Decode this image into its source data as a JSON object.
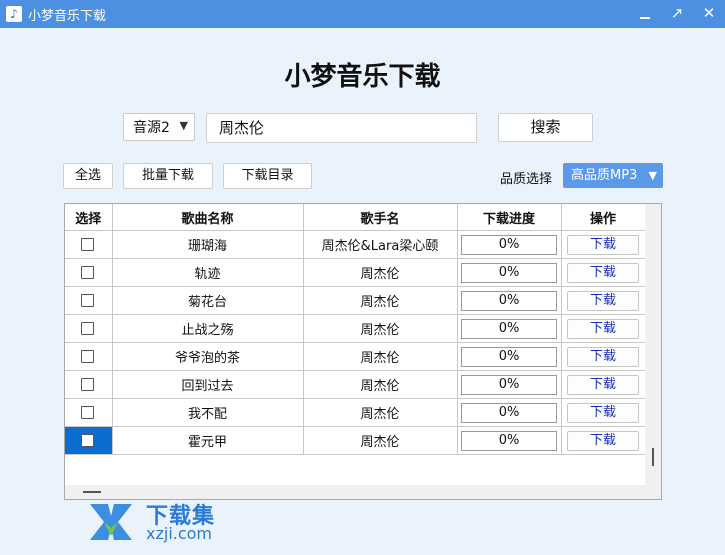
{
  "window": {
    "title": "小梦音乐下载",
    "icon": "music-note-icon",
    "controls": [
      "minimize",
      "maximize",
      "close"
    ]
  },
  "header": {
    "app_title": "小梦音乐下载"
  },
  "search": {
    "source_value": "音源2",
    "query_value": "周杰伦",
    "search_label": "搜索"
  },
  "toolbar": {
    "select_all_label": "全选",
    "batch_download_label": "批量下载",
    "download_dir_label": "下载目录",
    "quality_label": "品质选择",
    "quality_value": "高品质MP3"
  },
  "table": {
    "columns": [
      "选择",
      "歌曲名称",
      "歌手名",
      "下载进度",
      "操作"
    ],
    "rows": [
      {
        "song": "珊瑚海",
        "artist": "周杰伦&Lara梁心颐",
        "progress": "0%",
        "action": "下载"
      },
      {
        "song": "轨迹",
        "artist": "周杰伦",
        "progress": "0%",
        "action": "下载"
      },
      {
        "song": "菊花台",
        "artist": "周杰伦",
        "progress": "0%",
        "action": "下载"
      },
      {
        "song": "止战之殇",
        "artist": "周杰伦",
        "progress": "0%",
        "action": "下载"
      },
      {
        "song": "爷爷泡的茶",
        "artist": "周杰伦",
        "progress": "0%",
        "action": "下载"
      },
      {
        "song": "回到过去",
        "artist": "周杰伦",
        "progress": "0%",
        "action": "下载"
      },
      {
        "song": "我不配",
        "artist": "周杰伦",
        "progress": "0%",
        "action": "下载"
      },
      {
        "song": "霍元甲",
        "artist": "周杰伦",
        "progress": "0%",
        "action": "下载"
      }
    ]
  },
  "watermark": {
    "brand": "下载集",
    "domain": "xzji.com"
  },
  "colors": {
    "titlebar": "#4d8fe0",
    "background": "#eaf2fc",
    "quality_select": "#5b9ae8",
    "selected_cell": "#0a6ed1",
    "link_text": "#1a2fb5"
  }
}
